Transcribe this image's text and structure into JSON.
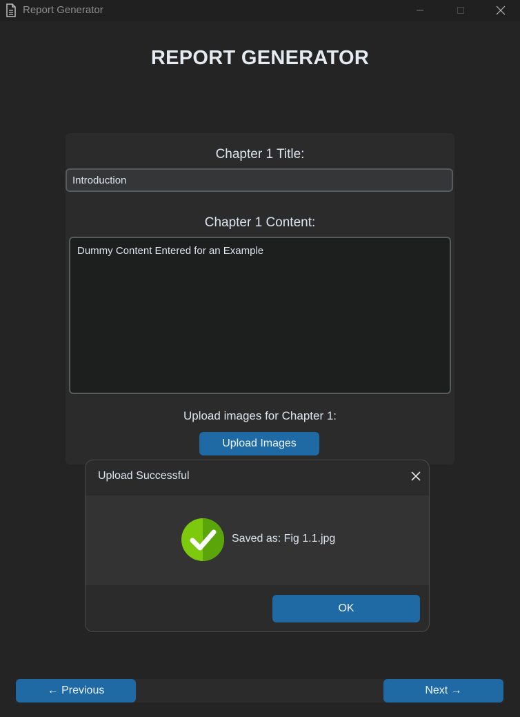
{
  "window": {
    "title": "Report Generator",
    "icon": "document-icon"
  },
  "app": {
    "heading": "REPORT GENERATOR"
  },
  "chapter": {
    "title_label": "Chapter 1 Title:",
    "title_value": "Introduction",
    "content_label": "Chapter 1 Content:",
    "content_value": "Dummy Content Entered for an Example",
    "upload_label": "Upload images for Chapter 1:",
    "upload_button": "Upload Images"
  },
  "dialog": {
    "title": "Upload Successful",
    "icon": "check-circle-icon",
    "message": "Saved as: Fig 1.1.jpg",
    "ok_button": "OK"
  },
  "navigation": {
    "previous": "← Previous",
    "next": "Next →"
  },
  "colors": {
    "background": "#242424",
    "frame": "#2b2b2b",
    "accent": "#1f6aa5",
    "success": "#7cc90e"
  }
}
